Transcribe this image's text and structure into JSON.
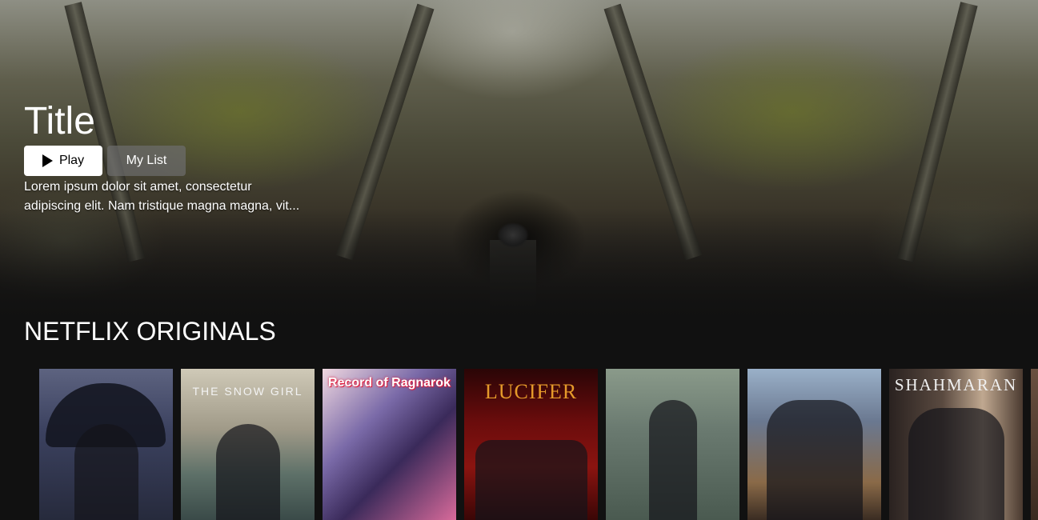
{
  "banner": {
    "title": "Title",
    "play_label": "Play",
    "my_list_label": "My List",
    "description": "Lorem ipsum dolor sit amet, consectetur adipiscing elit. Nam tristique magna magna, vit..."
  },
  "row": {
    "title": "NETFLIX ORIGINALS",
    "posters": [
      {
        "label": ""
      },
      {
        "label": "THE SNOW GIRL"
      },
      {
        "label": "Record of Ragnarok"
      },
      {
        "label": "LUCIFER"
      },
      {
        "label": ""
      },
      {
        "label": ""
      },
      {
        "label": "SHAHMARAN"
      }
    ]
  },
  "colors": {
    "background": "#111111",
    "play_button": "#ffffff",
    "my_list_button": "#6e6e6e"
  }
}
